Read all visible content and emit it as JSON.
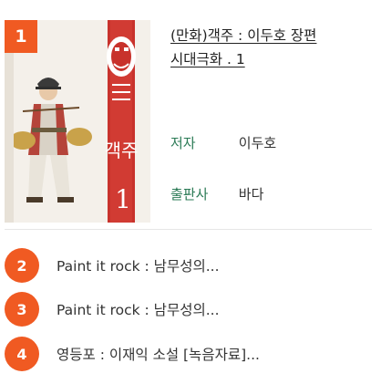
{
  "featured": {
    "rank": "1",
    "title": "(만화)객주 : 이두호 장편 시대극화 . 1",
    "cover_text": "객주",
    "cover_number": "1",
    "author_label": "저자",
    "author_value": "이두호",
    "publisher_label": "출판사",
    "publisher_value": "바다"
  },
  "list": [
    {
      "rank": "2",
      "title": "Paint it rock : 남무성의..."
    },
    {
      "rank": "3",
      "title": "Paint it rock : 남무성의..."
    },
    {
      "rank": "4",
      "title": "영등포 : 이재익 소설 [녹음자료]..."
    }
  ],
  "colors": {
    "accent": "#f05a22",
    "label_green": "#2a7a55",
    "cover_red": "#c8322c"
  }
}
